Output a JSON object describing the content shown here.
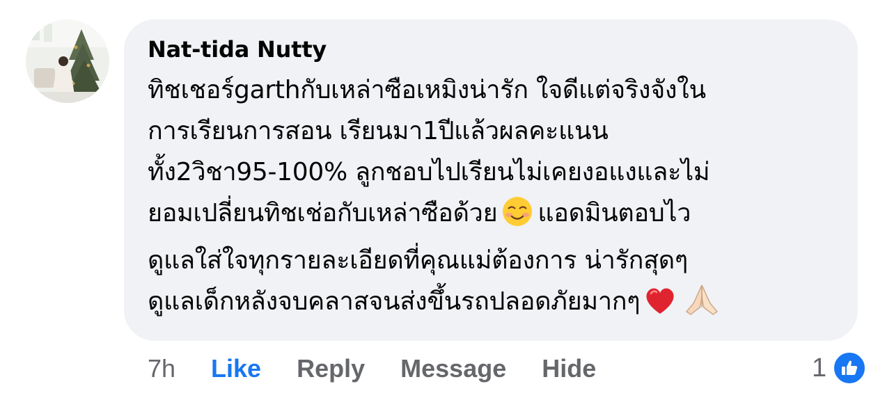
{
  "comment": {
    "author": "Nat-tida Nutty",
    "lines": [
      "ทิชเชอร์garthกับเหล่าซือเหมิงน่ารัก ใจดีแต่จริงจังใน",
      "การเรียนการสอน เรียนมา1ปีแล้วผลคะแนน",
      "ทั้ง2วิชา95-100%  ลูกชอบไปเรียนไม่เคยงอแงและไม่",
      "ยอมเปลี่ยนทิชเช่อกับเหล่าซือด้วย",
      "แอดมินตอบไว",
      "ดูแลใส่ใจทุกรายละเอียดที่คุณแม่ต้องการ น่ารักสุดๆ",
      "ดูแลเด็กหลังจบคลาสจนส่งขึ้นรถปลอดภัยมากๆ"
    ],
    "emojis": [
      "smiling-face-icon",
      "red-heart-icon",
      "folded-hands-icon"
    ]
  },
  "actions": {
    "time": "7h",
    "like": "Like",
    "reply": "Reply",
    "message": "Message",
    "hide": "Hide"
  },
  "reactions": {
    "count": "1",
    "icon": "thumbs-up-icon"
  },
  "colors": {
    "bubble": "#f0f2f5",
    "text": "#050505",
    "muted": "#65676b",
    "accent": "#1877f2"
  }
}
